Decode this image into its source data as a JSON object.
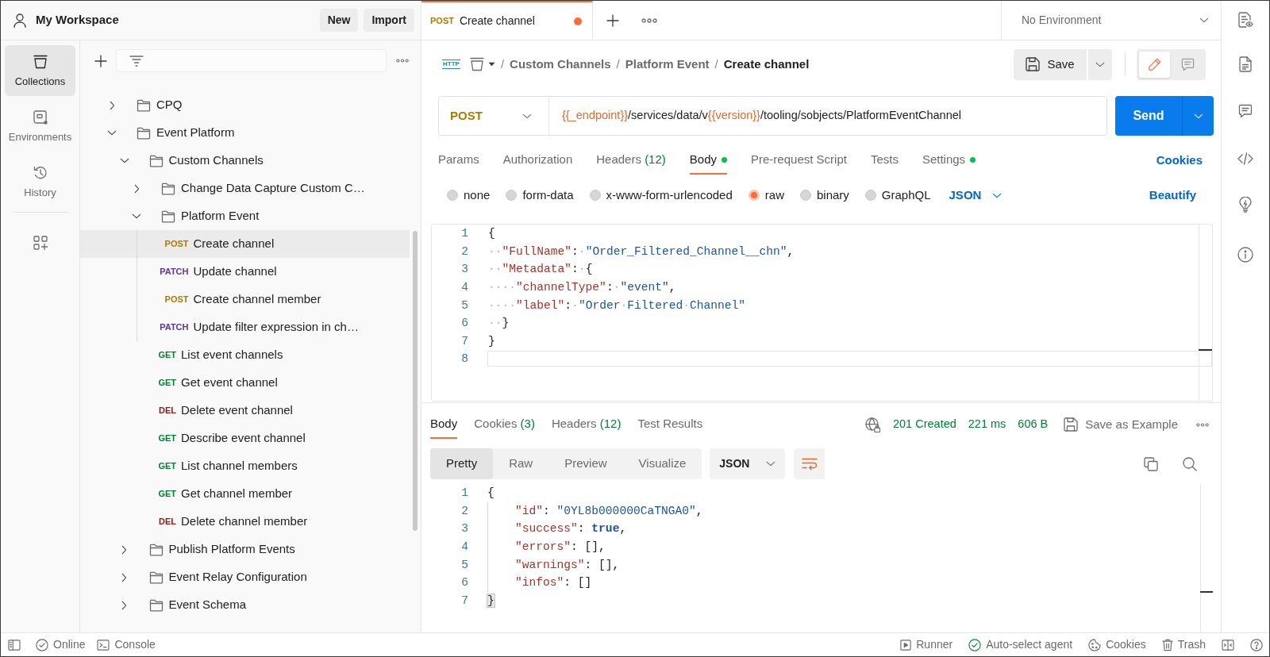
{
  "workspace": {
    "title": "My Workspace",
    "buttons": [
      {
        "label": "New"
      },
      {
        "label": "Import"
      }
    ]
  },
  "rail": [
    {
      "kind": "collections",
      "label": "Collections",
      "selected": true
    },
    {
      "kind": "environments",
      "label": "Environments",
      "selected": false
    },
    {
      "kind": "history",
      "label": "History",
      "selected": false
    }
  ],
  "tree": [
    {
      "kind": "folder",
      "label": "CPQ",
      "expanded": false,
      "selected": false
    },
    {
      "kind": "folder",
      "label": "Event Platform",
      "expanded": true,
      "selected": false,
      "children": [
        {
          "kind": "folder",
          "label": "Custom Channels",
          "expanded": true,
          "selected": false,
          "children": [
            {
              "kind": "folder",
              "label": "Change Data Capture Custom C…",
              "expanded": false,
              "selected": false
            },
            {
              "kind": "folder",
              "label": "Platform Event",
              "expanded": true,
              "selected": false,
              "children": [
                {
                  "kind": "request",
                  "method": "POST",
                  "color": "#ad7a03",
                  "label": "Create channel",
                  "selected": true
                },
                {
                  "kind": "request",
                  "method": "PATCH",
                  "color": "#623497",
                  "label": "Update channel",
                  "selected": false
                },
                {
                  "kind": "request",
                  "method": "POST",
                  "color": "#ad7a03",
                  "label": "Create channel member",
                  "selected": false
                },
                {
                  "kind": "request",
                  "method": "PATCH",
                  "color": "#623497",
                  "label": "Update filter expression in ch…",
                  "selected": false
                }
              ]
            },
            {
              "kind": "request",
              "method": "GET",
              "color": "#007f31",
              "label": "List event channels",
              "selected": false
            },
            {
              "kind": "request",
              "method": "GET",
              "color": "#007f31",
              "label": "Get event channel",
              "selected": false
            },
            {
              "kind": "request",
              "method": "DEL",
              "color": "#8e1a10",
              "label": "Delete event channel",
              "selected": false
            },
            {
              "kind": "request",
              "method": "GET",
              "color": "#007f31",
              "label": "Describe event channel",
              "selected": false
            },
            {
              "kind": "request",
              "method": "GET",
              "color": "#007f31",
              "label": "List channel members",
              "selected": false
            },
            {
              "kind": "request",
              "method": "GET",
              "color": "#007f31",
              "label": "Get channel member",
              "selected": false
            },
            {
              "kind": "request",
              "method": "DEL",
              "color": "#8e1a10",
              "label": "Delete channel member",
              "selected": false
            }
          ]
        },
        {
          "kind": "folder",
          "label": "Publish Platform Events",
          "expanded": false,
          "selected": false
        },
        {
          "kind": "folder",
          "label": "Event Relay Configuration",
          "expanded": false,
          "selected": false
        },
        {
          "kind": "folder",
          "label": "Event Schema",
          "expanded": false,
          "selected": false
        }
      ]
    }
  ],
  "tabs": [
    {
      "method": "POST",
      "color": "#ad7a03",
      "title": "Create channel",
      "unsaved": true,
      "selected": true
    }
  ],
  "environment": "No Environment",
  "protocol": "HTTP",
  "breadcrumb": [
    {
      "separator": "/",
      "label": "Custom Channels",
      "current": false
    },
    {
      "separator": "/",
      "label": "Platform Event",
      "current": false
    },
    {
      "separator": "/",
      "label": "Create channel",
      "current": true
    }
  ],
  "save_label": "Save",
  "modes": [
    {
      "kind": "edit",
      "selected": true
    },
    {
      "kind": "comments",
      "selected": false
    }
  ],
  "request": {
    "method": "POST",
    "url": [
      {
        "kind": "variable",
        "text": "{{_endpoint}}"
      },
      {
        "kind": "path",
        "text": "/services/data/v"
      },
      {
        "kind": "variable",
        "text": "{{version}}"
      },
      {
        "kind": "path",
        "text": "/tooling/sobjects/PlatformEventChannel"
      }
    ],
    "send_label": "Send"
  },
  "request_tabs": [
    {
      "label": "Params",
      "selected": false
    },
    {
      "label": "Authorization",
      "selected": false
    },
    {
      "label": "Headers",
      "count": "(12)",
      "selected": false
    },
    {
      "label": "Body",
      "dot": true,
      "selected": true
    },
    {
      "label": "Pre-request Script",
      "selected": false
    },
    {
      "label": "Tests",
      "selected": false
    },
    {
      "label": "Settings",
      "dot": true,
      "selected": false
    }
  ],
  "cookies_link": "Cookies",
  "body_modes": [
    {
      "label": "none",
      "selected": false
    },
    {
      "label": "form-data",
      "selected": false
    },
    {
      "label": "x-www-form-urlencoded",
      "selected": false
    },
    {
      "label": "raw",
      "selected": true
    },
    {
      "label": "binary",
      "selected": false
    },
    {
      "label": "GraphQL",
      "selected": false
    }
  ],
  "body_language": "JSON",
  "beautify_link": "Beautify",
  "request_body": [
    {
      "number": "1",
      "current": false,
      "tokens": [
        {
          "kind": "punct",
          "text": "{"
        }
      ]
    },
    {
      "number": "2",
      "current": false,
      "tokens": [
        {
          "kind": "ws",
          "text": "··"
        },
        {
          "kind": "key",
          "text": "\"FullName\""
        },
        {
          "kind": "punct",
          "text": ":"
        },
        {
          "kind": "ws",
          "text": "·"
        },
        {
          "kind": "string",
          "text": "\"Order_Filtered_Channel__chn\""
        },
        {
          "kind": "punct",
          "text": ","
        }
      ]
    },
    {
      "number": "3",
      "current": false,
      "tokens": [
        {
          "kind": "ws",
          "text": "··"
        },
        {
          "kind": "key",
          "text": "\"Metadata\""
        },
        {
          "kind": "punct",
          "text": ":"
        },
        {
          "kind": "ws",
          "text": "·"
        },
        {
          "kind": "punct",
          "text": "{"
        }
      ]
    },
    {
      "number": "4",
      "current": false,
      "tokens": [
        {
          "kind": "ws",
          "text": "····"
        },
        {
          "kind": "key",
          "text": "\"channelType\""
        },
        {
          "kind": "punct",
          "text": ":"
        },
        {
          "kind": "ws",
          "text": "·"
        },
        {
          "kind": "string",
          "text": "\"event\""
        },
        {
          "kind": "punct",
          "text": ","
        }
      ]
    },
    {
      "number": "5",
      "current": false,
      "tokens": [
        {
          "kind": "ws",
          "text": "····"
        },
        {
          "kind": "key",
          "text": "\"label\""
        },
        {
          "kind": "punct",
          "text": ":"
        },
        {
          "kind": "ws",
          "text": "·"
        },
        {
          "kind": "string",
          "text": "\"Order"
        },
        {
          "kind": "ws",
          "text": "·"
        },
        {
          "kind": "string",
          "text": "Filtered"
        },
        {
          "kind": "ws",
          "text": "·"
        },
        {
          "kind": "string",
          "text": "Channel\""
        }
      ]
    },
    {
      "number": "6",
      "current": false,
      "tokens": [
        {
          "kind": "ws",
          "text": "··"
        },
        {
          "kind": "punct",
          "text": "}"
        }
      ]
    },
    {
      "number": "7",
      "current": false,
      "tokens": [
        {
          "kind": "punct",
          "text": "}"
        }
      ]
    },
    {
      "number": "8",
      "current": true
    }
  ],
  "response": {
    "tabs": [
      {
        "label": "Body",
        "selected": true
      },
      {
        "label": "Cookies",
        "count": "(3)",
        "selected": false
      },
      {
        "label": "Headers",
        "count": "(12)",
        "selected": false
      },
      {
        "label": "Test Results",
        "selected": false
      }
    ],
    "status": "201 Created",
    "time": "221 ms",
    "size": "606 B",
    "save_example": "Save as Example",
    "views": [
      {
        "label": "Pretty",
        "selected": true
      },
      {
        "label": "Raw",
        "selected": false
      },
      {
        "label": "Preview",
        "selected": false
      },
      {
        "label": "Visualize",
        "selected": false
      }
    ],
    "format": "JSON",
    "wrap": true,
    "body": [
      {
        "number": "1",
        "tokens": [
          {
            "kind": "punct",
            "text": "{"
          }
        ],
        "children": [
          {
            "number": "2",
            "tokens": [
              {
                "kind": "key",
                "text": "\"id\""
              },
              {
                "kind": "punct",
                "text": ": "
              },
              {
                "kind": "string",
                "text": "\"0YL8b000000CaTNGA0\""
              },
              {
                "kind": "punct",
                "text": ","
              }
            ]
          },
          {
            "number": "3",
            "tokens": [
              {
                "kind": "key",
                "text": "\"success\""
              },
              {
                "kind": "punct",
                "text": ": "
              },
              {
                "kind": "keyword",
                "text": "true"
              },
              {
                "kind": "punct",
                "text": ","
              }
            ]
          },
          {
            "number": "4",
            "tokens": [
              {
                "kind": "key",
                "text": "\"errors\""
              },
              {
                "kind": "punct",
                "text": ": [],"
              }
            ]
          },
          {
            "number": "5",
            "tokens": [
              {
                "kind": "key",
                "text": "\"warnings\""
              },
              {
                "kind": "punct",
                "text": ": [],"
              }
            ]
          },
          {
            "number": "6",
            "tokens": [
              {
                "kind": "key",
                "text": "\"infos\""
              },
              {
                "kind": "punct",
                "text": ": []"
              }
            ]
          }
        ]
      },
      {
        "number": "7",
        "tokens": [
          {
            "kind": "brace_match",
            "text": "}"
          }
        ]
      }
    ]
  },
  "status_bar": {
    "left": [
      {
        "kind": "online",
        "label": "Online"
      },
      {
        "kind": "console",
        "label": "Console"
      }
    ],
    "right": [
      {
        "kind": "runner",
        "label": "Runner"
      },
      {
        "kind": "agent",
        "label": "Auto-select agent"
      },
      {
        "kind": "cookies",
        "label": "Cookies"
      },
      {
        "kind": "trash",
        "label": "Trash"
      }
    ]
  }
}
